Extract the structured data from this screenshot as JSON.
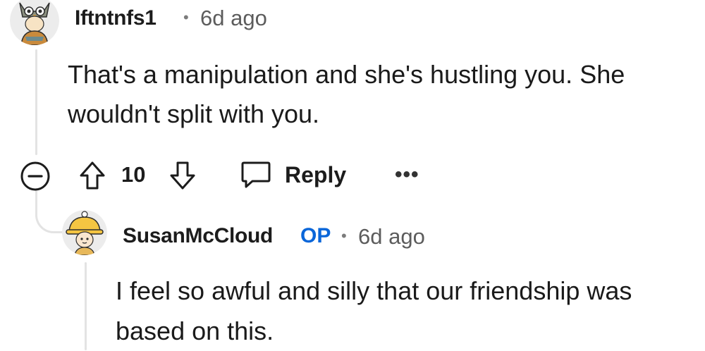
{
  "comment1": {
    "username": "Iftntnfs1",
    "separator": "•",
    "time": "6d ago",
    "body_line1": "That's a manipulation and she's hustling you. She",
    "body_line2": "wouldn't split with you.",
    "score": "10",
    "reply_label": "Reply",
    "more_label": "•••",
    "avatar_icon": "owl-costume-avatar-icon"
  },
  "comment2": {
    "username": "SusanMcCloud",
    "op_badge": "OP",
    "separator": "•",
    "time": "6d ago",
    "body_line1": "I feel so awful and silly that our friendship was",
    "body_line2": "based on this.",
    "avatar_icon": "yellow-hat-avatar-icon"
  },
  "colors": {
    "op_blue": "#0a66d9",
    "thread_line": "#e3e3e3",
    "meta_grey": "#5c5c5c"
  }
}
